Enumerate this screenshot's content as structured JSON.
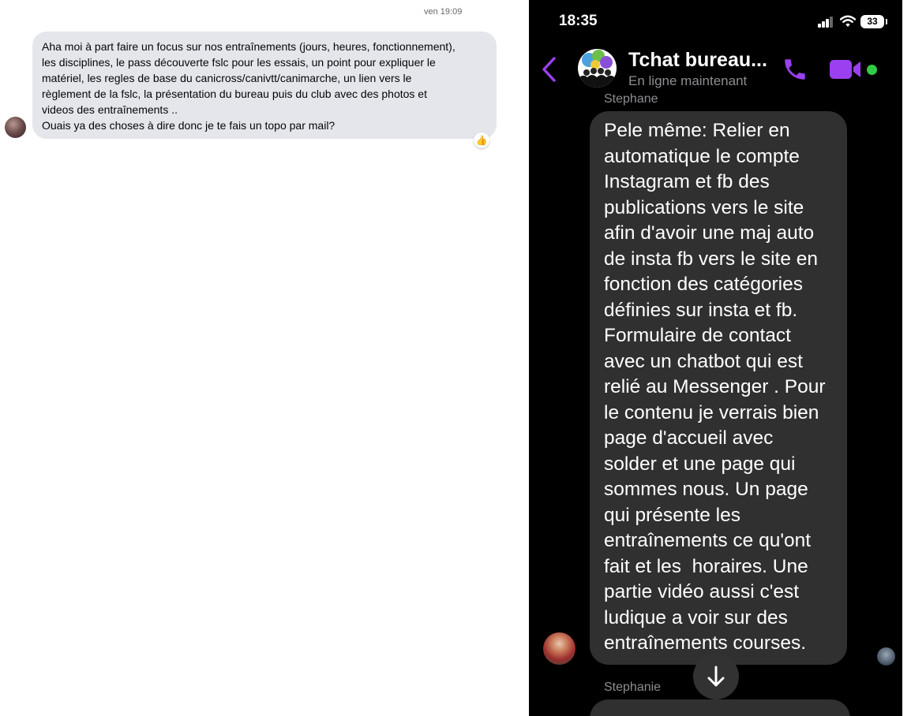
{
  "desktop": {
    "timestamp": "ven 19:09",
    "message_lines": [
      "Aha moi à part faire un focus sur nos entraînements (jours, heures, fonctionnement),",
      "les disciplines, le pass découverte fslc pour les essais, un point pour expliquer le",
      "matériel, les regles de base du canicross/canivtt/canimarche, un lien vers le",
      "règlement de la fslc, la présentation du bureau puis du club avec des photos et",
      "videos des entraînements ..",
      "Ouais ya des choses à dire donc je te fais un topo par mail?"
    ],
    "reaction_icon": "thumbs-up-icon",
    "reaction_emoji": "👍"
  },
  "phone": {
    "status_time": "18:35",
    "battery": "33",
    "chat_title": "Tchat bureau...",
    "chat_status": "En ligne maintenant",
    "sender_top": "Stephane",
    "message_lines": [
      "Pele même: Relier en",
      "automatique le compte",
      "Instagram et fb des",
      "publications vers le site",
      "afin d'avoir une maj auto",
      "de insta fb vers le site en",
      "fonction des catégories",
      "définies sur insta et fb.",
      "Formulaire de contact",
      "avec un chatbot qui est",
      "relié au Messenger . Pour",
      "le contenu je verrais bien",
      "page d'accueil avec",
      "solder et une page qui",
      "sommes nous. Un page",
      "qui présente les",
      "entraînements ce qu'ont",
      "fait et les  horaires. Une",
      "partie vidéo aussi c'est",
      "ludique a voir sur des",
      "entraînements courses."
    ],
    "sender_bottom": "Stephanie",
    "colors": {
      "accent": "#9b40f0",
      "online": "#31cc46",
      "bubble": "#303030",
      "background": "#000000"
    }
  }
}
